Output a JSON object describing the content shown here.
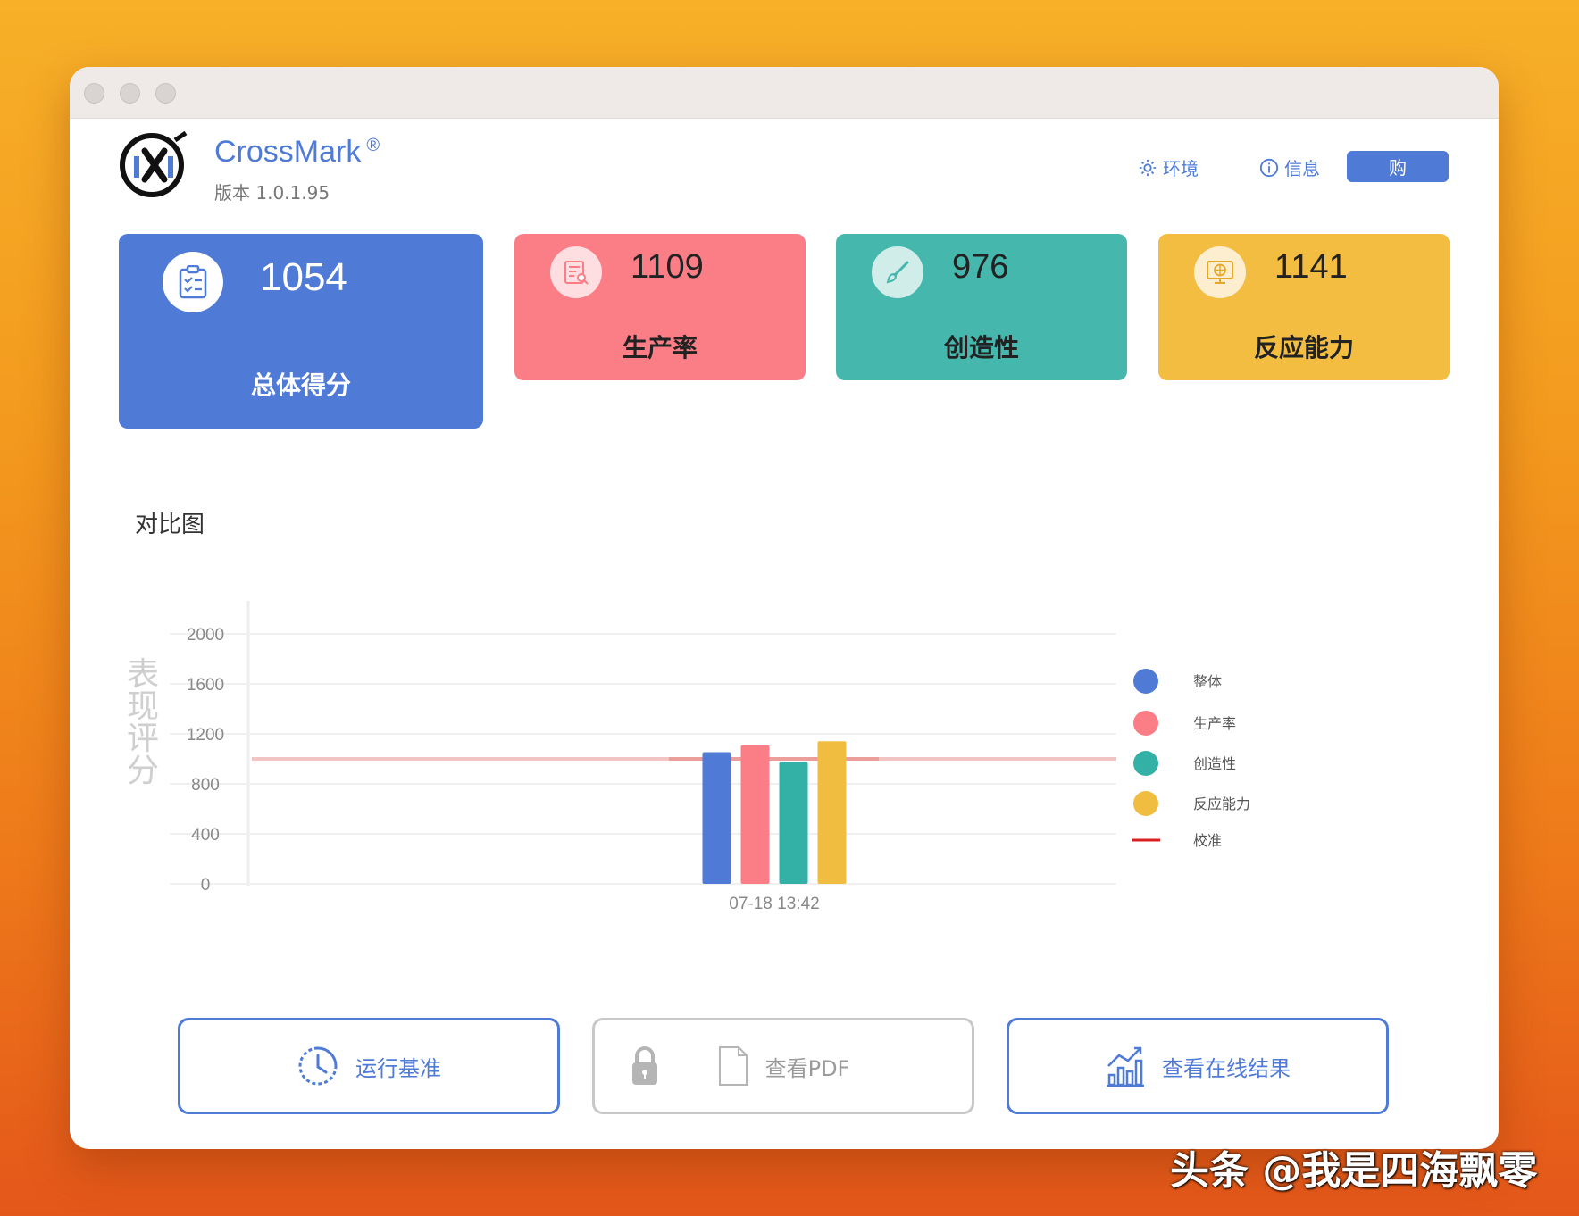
{
  "window": {
    "header": {
      "app_name": "CrossMark",
      "reg_mark": "®",
      "version": "版本 1.0.1.95",
      "env_label": "环境",
      "info_label": "信息",
      "buy_label": "购"
    },
    "cards": {
      "overall": {
        "score": "1054",
        "label": "总体得分",
        "color": "#4f7ad6",
        "icon": "clipboard-check-icon"
      },
      "productivity": {
        "score": "1109",
        "label": "生产率",
        "color": "#fb7e87",
        "icon": "document-search-icon"
      },
      "creativity": {
        "score": "976",
        "label": "创造性",
        "color": "#45b7ad",
        "icon": "brush-icon"
      },
      "responsiveness": {
        "score": "1141",
        "label": "反应能力",
        "color": "#f3bd42",
        "icon": "monitor-globe-icon"
      }
    },
    "section_title": "对比图",
    "actions": {
      "run_label": "运行基准",
      "pdf_label": "查看PDF",
      "online_label": "查看在线结果"
    }
  },
  "chart_data": {
    "type": "bar",
    "title": "",
    "ylabel": "表现评分",
    "xlabel": "",
    "categories": [
      "07-18 13:42"
    ],
    "ylim": [
      0,
      2000
    ],
    "yticks": [
      0,
      400,
      800,
      1200,
      1600,
      2000
    ],
    "series": [
      {
        "name": "整体",
        "values": [
          1054
        ],
        "color": "#4f7ad6"
      },
      {
        "name": "生产率",
        "values": [
          1109
        ],
        "color": "#fb7e87"
      },
      {
        "name": "创造性",
        "values": [
          976
        ],
        "color": "#33b1a6"
      },
      {
        "name": "反应能力",
        "values": [
          1141
        ],
        "color": "#f1bd40"
      }
    ],
    "reference_line": {
      "name": "校准",
      "value": 1000,
      "color": "#d92020"
    },
    "legend_position": "right",
    "grid": true
  },
  "watermark": "头条 @我是四海飘零"
}
